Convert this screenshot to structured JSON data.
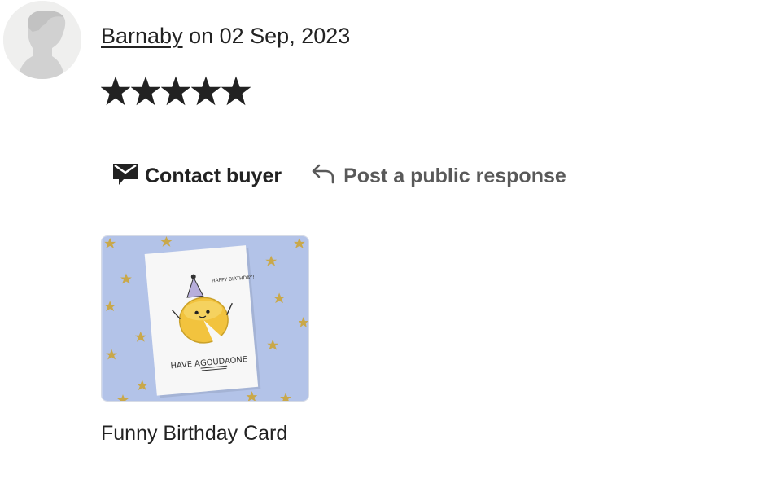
{
  "review": {
    "reviewer_name": "Barnaby",
    "date_text": " on 02 Sep, 2023",
    "rating": 5,
    "max_rating": 5,
    "avatar_icon": "default-user-silhouette-icon"
  },
  "actions": {
    "contact_label": "Contact buyer",
    "contact_icon": "message-icon",
    "respond_label": "Post a public response",
    "respond_icon": "reply-arrow-icon"
  },
  "product": {
    "title": "Funny Birthday Card",
    "card_text_top": "HAPPY BIRTHDAY!",
    "card_text_main_1": "HAVE A",
    "card_text_main_2": "GOUDA",
    "card_text_main_3": "ONE"
  },
  "colors": {
    "text": "#222222",
    "muted": "#595959",
    "star": "#222222",
    "card_bg": "#b3c3e8"
  }
}
